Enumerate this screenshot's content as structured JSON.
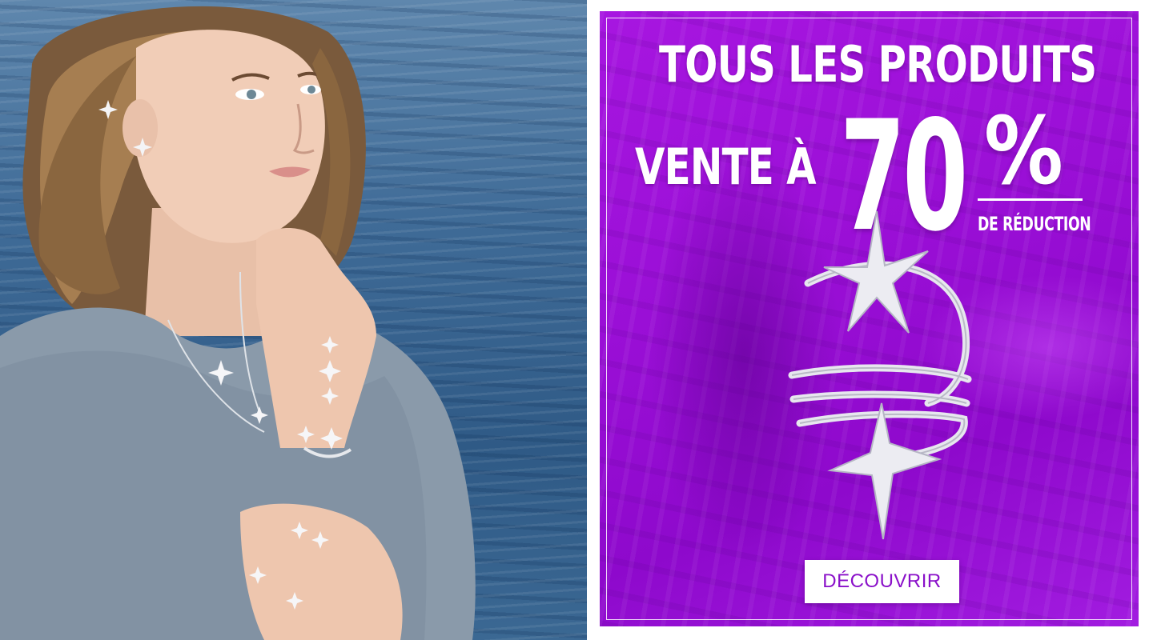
{
  "hero_photo": {
    "alt": "model-wearing-star-jewelry"
  },
  "promo": {
    "headline": "TOUS LES PRODUITS",
    "sale_prefix": "VENTE À",
    "discount_number": "70",
    "percent_sign": "%",
    "discount_suffix": "DE RÉDUCTION",
    "cta_label": "DÉCOUVRIR",
    "product_image": "star-ring-icon"
  },
  "colors": {
    "promo_background": "#9a0fd6",
    "cta_text": "#8a10c9",
    "text": "#ffffff"
  }
}
